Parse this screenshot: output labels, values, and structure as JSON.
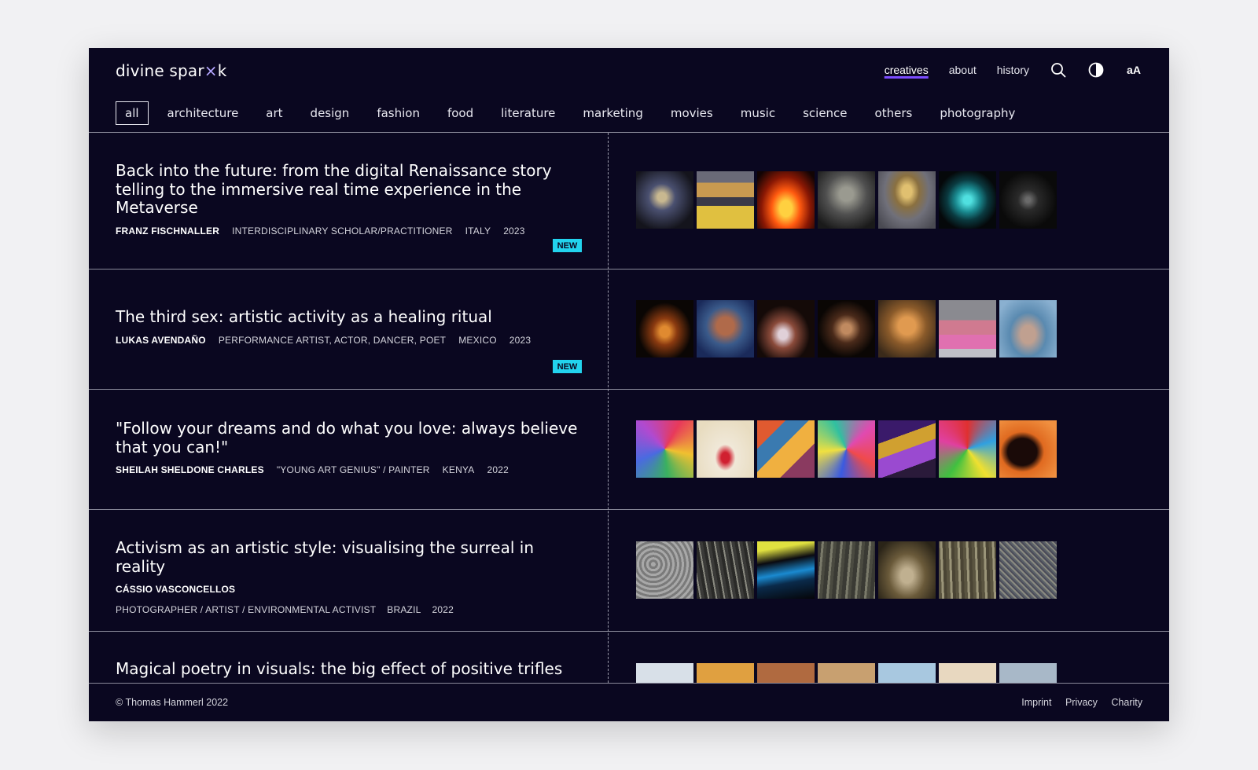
{
  "brand": {
    "name_start": "divine spar",
    "name_spark": "×",
    "name_end": "k"
  },
  "topnav": {
    "links": [
      "creatives",
      "about",
      "history"
    ],
    "active": "creatives",
    "icons": [
      "search-icon",
      "contrast-icon"
    ],
    "font_toggle": "aA"
  },
  "categories": [
    "all",
    "architecture",
    "art",
    "design",
    "fashion",
    "food",
    "literature",
    "marketing",
    "movies",
    "music",
    "science",
    "others",
    "photography"
  ],
  "active_category": "all",
  "accent_colors": {
    "background": "#0a0720",
    "badge": "#22d3ee",
    "active_underline": "#7c4dff"
  },
  "entries": [
    {
      "title": "Back into the future: from the digital Renaissance story telling to the immersive real time experience in the Metaverse",
      "name": "FRANZ FISCHNALLER",
      "role": "INTERDISCIPLINARY SCHOLAR/PRACTITIONER",
      "country": "ITALY",
      "year": "2023",
      "badge": "NEW"
    },
    {
      "title": "The third sex: artistic activity as a healing ritual",
      "name": "LUKAS AVENDAÑO",
      "role": "PERFORMANCE ARTIST, ACTOR, DANCER, POET",
      "country": "MEXICO",
      "year": "2023",
      "badge": "NEW"
    },
    {
      "title": "\"Follow your dreams and do what you love: always believe that you can!\"",
      "name": "SHEILAH SHELDONE CHARLES",
      "role": "\"YOUNG ART GENIUS\" / PAINTER",
      "country": "KENYA",
      "year": "2022"
    },
    {
      "title": "Activism as an artistic style: visualising the surreal in reality",
      "name": "CÁSSIO VASCONCELLOS",
      "role": "PHOTOGRAPHER / ARTIST / ENVIRONMENTAL ACTIVIST",
      "country": "BRAZIL",
      "year": "2022"
    },
    {
      "title": "Magical poetry in visuals: the big effect of positive trifles"
    }
  ],
  "footer": {
    "copyright": "© Thomas Hammerl 2022",
    "links": [
      "Imprint",
      "Privacy",
      "Charity"
    ]
  }
}
